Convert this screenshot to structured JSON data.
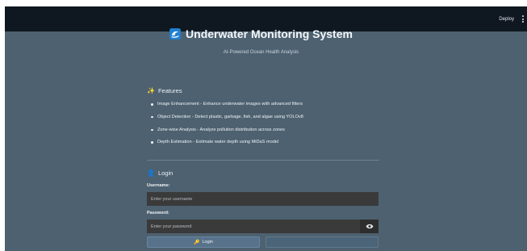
{
  "topbar": {
    "deploy_label": "Deploy",
    "menu_icon": "kebab-menu-icon"
  },
  "header": {
    "title": "Underwater Monitoring System",
    "subtitle": "AI-Powered Ocean Health Analysis",
    "icon": "wave-icon"
  },
  "features": {
    "heading": "Features",
    "icon": "sparkle-icon",
    "items": [
      "Image Enhancement - Enhance underwater images with advanced filters",
      "Object Detection - Detect plastic, garbage, fish, and algae using YOLOv8",
      "Zone-wise Analysis - Analyze pollution distribution across zones",
      "Depth Estimation - Estimate water depth using MiDaS model"
    ]
  },
  "login": {
    "heading": "Login",
    "icon": "user-icon",
    "username_label": "Username:",
    "username_placeholder": "Enter your username",
    "password_label": "Password:",
    "password_placeholder": "Enter your password",
    "show_password_icon": "eye-icon",
    "login_button": "Login",
    "login_button_icon": "key-icon"
  },
  "colors": {
    "page_bg": "#4d6170",
    "topbar_bg": "#0f1720",
    "input_bg": "#3a3a3a",
    "button_bg": "#57728a"
  }
}
